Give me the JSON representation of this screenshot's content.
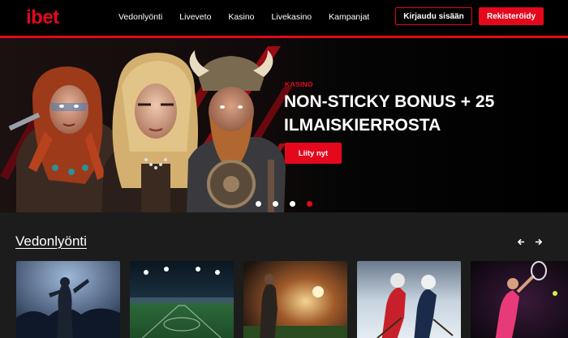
{
  "header": {
    "logo": "ibet",
    "nav": [
      "Vedonlyönti",
      "Liveveto",
      "Kasino",
      "Livekasino",
      "Kampanjat"
    ],
    "login_label": "Kirjaudu sisään",
    "register_label": "Rekisteröidy"
  },
  "hero": {
    "tag": "KASINO",
    "title": "NON-STICKY BONUS + 25 ILMAISKIERROSTA",
    "cta_label": "Liity nyt",
    "slides": 4,
    "active_slide": 4
  },
  "section": {
    "title": "Vedonlyönti",
    "prev_icon": "arrow-left-icon",
    "next_icon": "arrow-right-icon",
    "cards": [
      {
        "name": "fans-card",
        "icon": "stadium-fans-image"
      },
      {
        "name": "stadium-card",
        "icon": "stadium-field-image"
      },
      {
        "name": "football-card",
        "icon": "football-player-image"
      },
      {
        "name": "hockey-card",
        "icon": "ice-hockey-image"
      },
      {
        "name": "tennis-card",
        "icon": "tennis-player-image"
      }
    ]
  },
  "colors": {
    "brand_red": "#e5081c",
    "header_bg": "#000000",
    "section_bg": "#1c1c1c"
  }
}
